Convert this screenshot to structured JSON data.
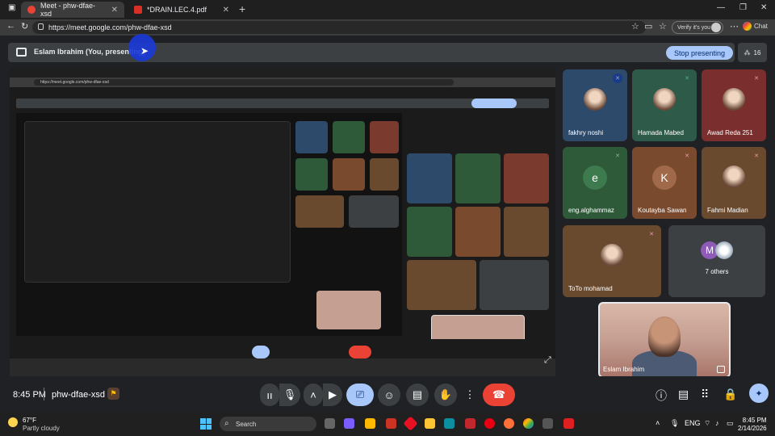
{
  "browser": {
    "tabs": [
      {
        "title": "Meet - phw-dfae-xsd",
        "active": true
      },
      {
        "title": "*DRAIN.LEC.4.pdf",
        "active": false
      }
    ],
    "url": "https://meet.google.com/phw-dfae-xsd",
    "verify_label": "Verify it's you",
    "chat_label": "Chat"
  },
  "meet": {
    "presenting_text": "Eslam Ibrahim (You, presenting)",
    "stop_label": "Stop presenting",
    "participant_count": "16",
    "participants": [
      {
        "name": "fakhry noshi",
        "kind": "photo"
      },
      {
        "name": "Hamada Mabed",
        "kind": "photo"
      },
      {
        "name": "Awad Reda 251",
        "kind": "photo"
      },
      {
        "name": "eng.alghammaz",
        "kind": "letter",
        "letter": "e"
      },
      {
        "name": "Koutayba Sawan",
        "kind": "letter",
        "letter": "K"
      },
      {
        "name": "Fahmi Madian",
        "kind": "photo"
      },
      {
        "name": "ToTo mohamad",
        "kind": "photo"
      }
    ],
    "others": {
      "label": "7 others",
      "letter": "M"
    },
    "self_name": "Eslam Ibrahim",
    "time": "8:45 PM",
    "meeting_code": "phw-dfae-xsd"
  },
  "nested": {
    "url": "https://meet.google.com/phw-dfae-xsd"
  },
  "taskbar": {
    "temp": "67°F",
    "condition": "Partly cloudy",
    "search_label": "Search",
    "lang": "ENG",
    "time": "8:45 PM",
    "date": "2/14/2026"
  },
  "colors": {
    "accent": "#a8c7fa",
    "end_call": "#ea4335",
    "tile_green": "#2e5a3a",
    "tile_brown": "#7a4a2e",
    "tile_blue": "#2d4a6a"
  }
}
